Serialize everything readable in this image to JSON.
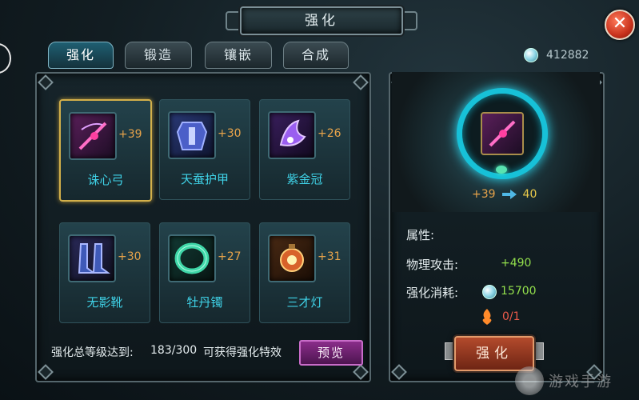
{
  "window": {
    "title": "强化"
  },
  "tabs": [
    {
      "label": "强化",
      "active": true
    },
    {
      "label": "锻造",
      "active": false
    },
    {
      "label": "镶嵌",
      "active": false
    },
    {
      "label": "合成",
      "active": false
    }
  ],
  "currency": {
    "icon": "silver-gem-icon",
    "value": "412882"
  },
  "items": [
    {
      "name": "诛心弓",
      "level": "+39",
      "icon": "bow-icon",
      "selected": true
    },
    {
      "name": "天蚕护甲",
      "level": "+30",
      "icon": "armor-icon",
      "selected": false
    },
    {
      "name": "紫金冠",
      "level": "+26",
      "icon": "crown-icon",
      "selected": false
    },
    {
      "name": "无影靴",
      "level": "+30",
      "icon": "boots-icon",
      "selected": false
    },
    {
      "name": "牡丹镯",
      "level": "+27",
      "icon": "bracelet-icon",
      "selected": false
    },
    {
      "name": "三才灯",
      "level": "+31",
      "icon": "lantern-icon",
      "selected": false
    }
  ],
  "total": {
    "label": "强化总等级达到:",
    "progress": "183/300",
    "reward_text": "可获得强化特效",
    "preview_label": "预览"
  },
  "upgrade": {
    "from": "+39",
    "to": "40"
  },
  "attributes": {
    "header": "属性:",
    "rows": [
      {
        "label": "物理攻击:",
        "value": "+490"
      }
    ],
    "cost_label": "强化消耗:",
    "cost_value": "15700",
    "material_count": "0/1"
  },
  "enhance_button": "强化",
  "watermark": "游戏手游"
}
